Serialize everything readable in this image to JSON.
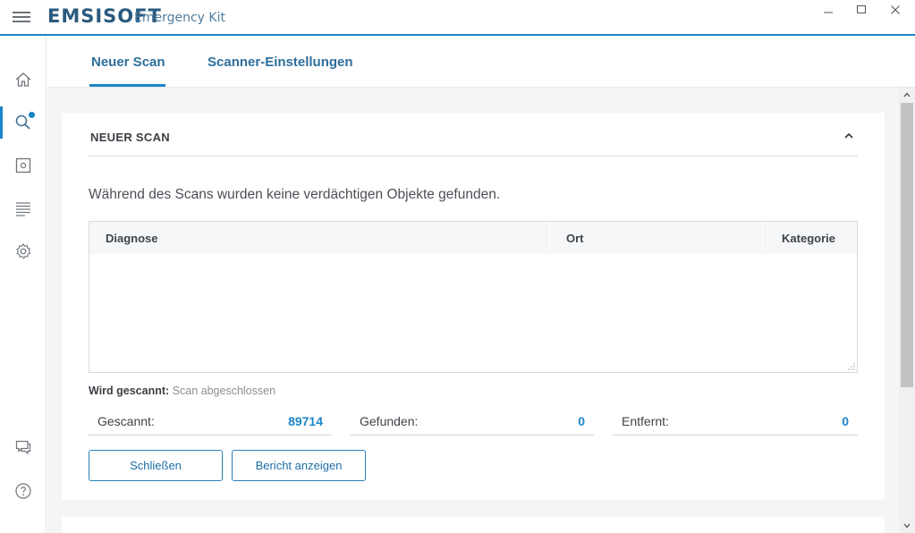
{
  "app": {
    "brand": "EMSISOFT",
    "subtitle": "Emergency Kit"
  },
  "window": {
    "minimize": "—",
    "maximize": "☐",
    "close": "✕"
  },
  "nav": {
    "items": [
      {
        "name": "home-icon",
        "active": false
      },
      {
        "name": "search-icon",
        "active": true
      },
      {
        "name": "quarantine-icon",
        "active": false
      },
      {
        "name": "logs-icon",
        "active": false
      },
      {
        "name": "settings-icon",
        "active": false
      }
    ],
    "bottom": [
      {
        "name": "chat-icon"
      },
      {
        "name": "help-icon"
      }
    ]
  },
  "tabs": [
    {
      "label": "Neuer Scan",
      "active": true
    },
    {
      "label": "Scanner-Einstellungen",
      "active": false
    }
  ],
  "card": {
    "title": "NEUER SCAN",
    "message": "Während des Scans wurden keine verdächtigen Objekte gefunden.",
    "table": {
      "columns": [
        "Diagnose",
        "Ort",
        "Kategorie"
      ],
      "rows": []
    },
    "scanning_label": "Wird gescannt:",
    "scanning_value": "Scan abgeschlossen",
    "stats": [
      {
        "label": "Gescannt:",
        "value": "89714"
      },
      {
        "label": "Gefunden:",
        "value": "0"
      },
      {
        "label": "Entfernt:",
        "value": "0"
      }
    ],
    "buttons": {
      "close": "Schließen",
      "report": "Bericht anzeigen"
    }
  },
  "colors": {
    "accent": "#1b86c7",
    "brand": "#2a5a7e",
    "background": "#f4f5f6"
  }
}
